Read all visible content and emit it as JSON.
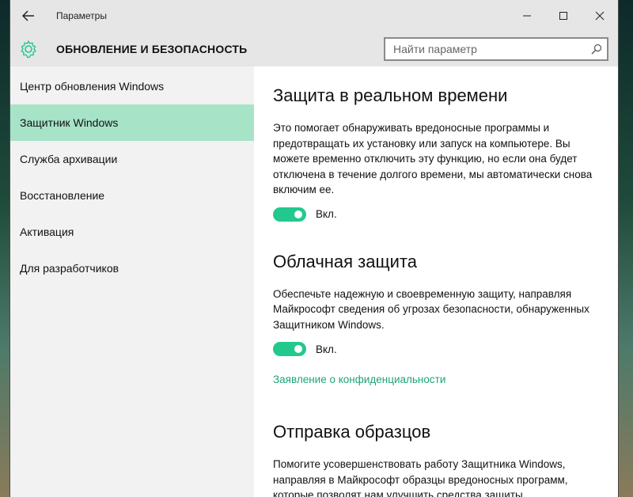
{
  "window": {
    "title": "Параметры"
  },
  "header": {
    "title": "ОБНОВЛЕНИЕ И БЕЗОПАСНОСТЬ",
    "search_placeholder": "Найти параметр"
  },
  "sidebar": {
    "items": [
      {
        "label": "Центр обновления Windows",
        "selected": false
      },
      {
        "label": "Защитник Windows",
        "selected": true
      },
      {
        "label": "Служба архивации",
        "selected": false
      },
      {
        "label": "Восстановление",
        "selected": false
      },
      {
        "label": "Активация",
        "selected": false
      },
      {
        "label": "Для разработчиков",
        "selected": false
      }
    ]
  },
  "sections": {
    "realtime": {
      "title": "Защита в реальном времени",
      "text": "Это помогает обнаруживать вредоносные программы и предотвращать их установку или запуск на компьютере. Вы можете временно отключить эту функцию, но если она будет отключена в течение долгого времени, мы автоматически снова включим ее.",
      "toggle_label": "Вкл.",
      "toggle_on": true
    },
    "cloud": {
      "title": "Облачная защита",
      "text": "Обеспечьте надежную и своевременную защиту, направляя Майкрософт сведения об угрозах безопасности, обнаруженных Защитником Windows.",
      "toggle_label": "Вкл.",
      "toggle_on": true,
      "link": "Заявление о конфиденциальности"
    },
    "samples": {
      "title": "Отправка образцов",
      "text": "Помогите усовершенствовать работу Защитника Windows, направляя в Майкрософт образцы вредоносных программ, которые позволят нам улучшить средства защиты."
    }
  },
  "colors": {
    "accent": "#22c98c",
    "selected_bg": "#a6e3c7",
    "link": "#1fa37a"
  },
  "icons": {
    "back": "arrow-left-icon",
    "settings": "gear-icon",
    "search": "search-icon",
    "minimize": "minimize-icon",
    "maximize": "maximize-icon",
    "close": "close-icon"
  }
}
